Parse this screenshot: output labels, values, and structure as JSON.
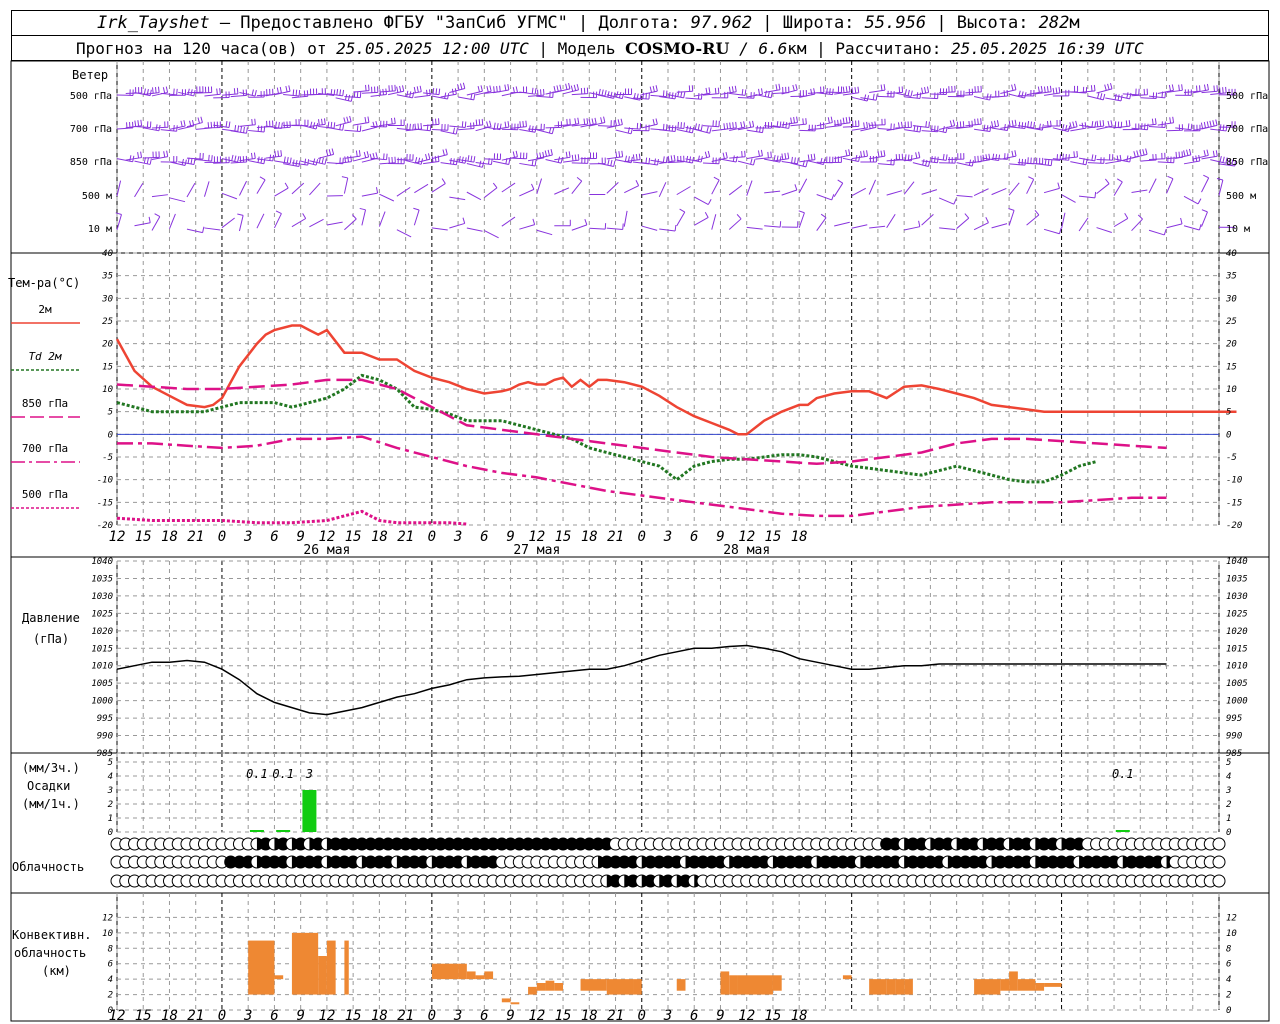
{
  "header": {
    "station": "Irk_Tayshet",
    "provider": " — Предоставлено ФГБУ \"ЗапСиб УГМС\" | Долгота: ",
    "lon": "97.962",
    "lat_label": " | Широта: ",
    "lat": "55.956",
    "alt_label": " | Высота: ",
    "alt": "282",
    "alt_unit": "м",
    "forecast_label": "Прогноз на 120 часа(ов) от ",
    "forecast_from": "25.05.2025 12:00 UTC",
    "model_label": "  | Модель ",
    "model": "COSMO-RU",
    "res": " / 6.6",
    "res_unit": "км",
    "calc_label": " | Рассчитано: ",
    "calc_time": "25.05.2025 16:39 UTC"
  },
  "panels": {
    "wind": {
      "title": "Ветер",
      "levels": [
        "500 гПа",
        "700 гПа",
        "850 гПа",
        "500 м",
        "10  м"
      ]
    },
    "temp": {
      "title": "Тем-ра(°С)",
      "legend": [
        "2м",
        "Td  2м",
        "850 гПа",
        "700 гПа",
        "500 гПа"
      ],
      "legend_colors": [
        "#ee4433",
        "#227722",
        "#dd1188",
        "#dd1188",
        "#dd1188"
      ],
      "ylim": [
        -20,
        40
      ]
    },
    "pressure": {
      "title": "Давление",
      "unit": "(гПа)",
      "ylim": [
        985,
        1040
      ]
    },
    "precip": {
      "title_top": "(мм/3ч.)",
      "title": "Осадки",
      "title_bottom": "(мм/1ч.)",
      "ylim": [
        0,
        5
      ],
      "annotations": [
        {
          "t": 16,
          "label": "0.1"
        },
        {
          "t": 19,
          "label": "0.1"
        },
        {
          "t": 22,
          "label": "3"
        },
        {
          "t": 115,
          "label": "0.1"
        }
      ]
    },
    "clouds": {
      "title": "Облачность"
    },
    "conv": {
      "title": [
        "Конвективн.",
        "облачность",
        "(км)"
      ],
      "ylim": [
        0,
        14
      ]
    }
  },
  "xaxis": {
    "hour_labels": [
      "12",
      "15",
      "18",
      "21",
      "0",
      "3",
      "6",
      "9",
      "12",
      "15",
      "18",
      "21",
      "0",
      "3",
      "6",
      "9",
      "12",
      "15",
      "18",
      "21",
      "0",
      "3",
      "6",
      "9",
      "12",
      "15",
      "18"
    ],
    "day_labels": [
      {
        "t": 24,
        "label": "26 мая"
      },
      {
        "t": 48,
        "label": "27 мая"
      },
      {
        "t": 72,
        "label": "28 мая"
      }
    ]
  },
  "chart_data": [
    {
      "type": "line",
      "title": "Тем-ра(°С)",
      "xlabel": "",
      "ylabel": "",
      "ylim": [
        -20,
        40
      ],
      "series": [
        {
          "name": "2м",
          "x": [
            0,
            2,
            4,
            6,
            8,
            10,
            11,
            12,
            14,
            16,
            17,
            18,
            20,
            21,
            22,
            23,
            24,
            26,
            28,
            30,
            32,
            34,
            36,
            38,
            40,
            42,
            44,
            45,
            46,
            47,
            48,
            49,
            50,
            51,
            52,
            53,
            54,
            55,
            56,
            58,
            60,
            62,
            64,
            66,
            68,
            70,
            71,
            72,
            74,
            76,
            78,
            79,
            80,
            82,
            84,
            86,
            88,
            90,
            92,
            94,
            96,
            98,
            100,
            102,
            104,
            106,
            108,
            110,
            112,
            114,
            116,
            118,
            120,
            122,
            124,
            126,
            128
          ],
          "y": [
            21,
            14,
            10.5,
            8.5,
            6.5,
            6,
            6.5,
            8,
            15,
            20,
            22,
            23,
            24,
            24,
            23,
            22,
            23,
            18,
            18,
            16.5,
            16.5,
            14,
            12.5,
            11.5,
            10,
            9,
            9.5,
            10,
            11,
            11.5,
            11,
            11,
            12,
            12.5,
            10.5,
            12,
            10.5,
            12,
            12,
            11.5,
            10.5,
            8.5,
            6,
            4,
            2.5,
            1,
            0,
            0,
            3,
            5,
            6.5,
            6.5,
            8,
            9,
            9.5,
            9.5,
            8,
            10.5,
            10.8,
            10,
            9,
            8,
            6.5,
            6,
            5.5,
            5,
            5,
            5,
            5,
            5,
            5,
            5,
            5,
            5,
            5,
            5,
            5
          ]
        },
        {
          "name": "Td  2м",
          "x": [
            0,
            2,
            4,
            6,
            8,
            10,
            12,
            14,
            16,
            18,
            20,
            22,
            24,
            26,
            28,
            30,
            32,
            34,
            36,
            38,
            40,
            42,
            44,
            46,
            48,
            50,
            52,
            54,
            56,
            58,
            60,
            62,
            64,
            66,
            68,
            70,
            72,
            74,
            76,
            78,
            80,
            82,
            84,
            86,
            88,
            90,
            92,
            94,
            96,
            98,
            100,
            102,
            104,
            106,
            108,
            110,
            112
          ],
          "y": [
            7,
            6,
            5,
            5,
            5,
            5,
            6,
            7,
            7,
            7,
            6,
            7,
            8,
            10,
            13,
            12,
            10,
            6,
            5.5,
            4.5,
            3,
            3,
            3,
            2,
            1,
            0,
            -1,
            -3,
            -4,
            -5,
            -6,
            -7,
            -10,
            -7,
            -6,
            -5.5,
            -5.5,
            -5,
            -4.5,
            -4.5,
            -5,
            -6,
            -7,
            -7.5,
            -8,
            -8.5,
            -9,
            -8,
            -7,
            -8,
            -9,
            -10,
            -10.5,
            -10.5,
            -9,
            -7,
            -6
          ]
        },
        {
          "name": "850 гПа",
          "x": [
            0,
            4,
            8,
            12,
            16,
            20,
            24,
            26,
            28,
            30,
            32,
            34,
            36,
            38,
            40,
            44,
            48,
            52,
            56,
            60,
            64,
            68,
            72,
            76,
            80,
            84,
            88,
            92,
            96,
            100,
            104,
            108,
            112,
            116,
            120
          ],
          "y": [
            11,
            10.5,
            10,
            10,
            10.5,
            11,
            12,
            12,
            12,
            11,
            10,
            8,
            6,
            4,
            2,
            1,
            0,
            -1,
            -2,
            -3,
            -4,
            -5,
            -5.5,
            -6,
            -6.5,
            -6,
            -5,
            -4,
            -2,
            -1,
            -1,
            -1.5,
            -2,
            -2.5,
            -3
          ]
        },
        {
          "name": "700 гПа",
          "x": [
            0,
            4,
            8,
            12,
            16,
            20,
            24,
            28,
            32,
            36,
            40,
            44,
            48,
            52,
            56,
            60,
            64,
            68,
            72,
            76,
            80,
            84,
            88,
            92,
            96,
            100,
            104,
            108,
            112,
            116,
            120
          ],
          "y": [
            -2,
            -2,
            -2.5,
            -3,
            -2.5,
            -1,
            -1,
            -0.5,
            -3,
            -5,
            -7,
            -8.5,
            -9.5,
            -11,
            -12.5,
            -13.5,
            -14.5,
            -15.5,
            -16.5,
            -17.5,
            -18,
            -18,
            -17,
            -16,
            -15.5,
            -15,
            -15,
            -15,
            -14.5,
            -14,
            -14
          ]
        },
        {
          "name": "500 гПа",
          "x": [
            0,
            4,
            8,
            12,
            16,
            20,
            24,
            26,
            28,
            30,
            32,
            34,
            36,
            38,
            40
          ],
          "y": [
            -18.5,
            -19,
            -19,
            -19,
            -19.5,
            -19.5,
            -19,
            -18,
            -17,
            -19,
            -19.5,
            -19.5,
            -19.5,
            -19.5,
            -19.8
          ]
        }
      ]
    },
    {
      "type": "line",
      "title": "Давление",
      "xlabel": "",
      "ylabel": "(гПа)",
      "ylim": [
        985,
        1040
      ],
      "series": [
        {
          "name": "",
          "x": [
            0,
            2,
            4,
            6,
            8,
            10,
            12,
            14,
            16,
            18,
            20,
            22,
            24,
            26,
            28,
            30,
            32,
            34,
            36,
            38,
            40,
            42,
            44,
            46,
            48,
            50,
            52,
            54,
            56,
            58,
            60,
            62,
            64,
            66,
            68,
            70,
            72,
            74,
            76,
            78,
            80,
            82,
            84,
            86,
            88,
            90,
            92,
            94,
            96,
            98,
            100,
            102,
            104,
            106,
            108,
            110,
            112,
            114,
            116,
            118,
            120
          ],
          "y": [
            1009,
            1010,
            1011,
            1011,
            1011.5,
            1011,
            1009,
            1006,
            1002,
            999.5,
            998,
            996.5,
            996,
            997,
            998,
            999.5,
            1001,
            1002,
            1003.5,
            1004.5,
            1006,
            1006.5,
            1006.8,
            1007,
            1007.5,
            1008,
            1008.5,
            1009,
            1009,
            1010,
            1011.5,
            1013,
            1014,
            1015,
            1015,
            1015.5,
            1015.8,
            1015,
            1014,
            1012,
            1011,
            1010,
            1009,
            1009,
            1009.5,
            1010,
            1010,
            1010.5,
            1010.5,
            1010.5,
            1010.5,
            1010.5,
            1010.5,
            1010.5,
            1010.5,
            1010.5,
            1010.5,
            1010.5,
            1010.5,
            1010.5,
            1010.5
          ]
        }
      ]
    },
    {
      "type": "bar",
      "title": "Осадки",
      "xlabel": "",
      "ylabel": "(мм/3ч.)",
      "ylim": [
        0,
        5
      ],
      "series": [
        {
          "name": "",
          "x": [
            16,
            19,
            22,
            115
          ],
          "values": [
            0.1,
            0.1,
            3,
            0.1
          ]
        }
      ]
    },
    {
      "type": "bar",
      "title": "Конвективн. облачность",
      "xlabel": "",
      "ylabel": "(км)",
      "ylim": [
        0,
        14
      ],
      "series": [
        {
          "name": "",
          "x_start": [
            15,
            18,
            20,
            23,
            24,
            26,
            36,
            39,
            40,
            41,
            42,
            44,
            45,
            47,
            48,
            49,
            50,
            53,
            56,
            59,
            64,
            69,
            70,
            71,
            75,
            83,
            86,
            88,
            89,
            90,
            98,
            101,
            102,
            103,
            105,
            106
          ],
          "x_end": [
            18,
            19,
            23,
            24,
            25,
            26.5,
            39,
            40,
            41,
            42,
            43,
            45,
            46,
            48,
            49,
            50,
            51,
            56,
            59,
            60,
            65,
            70,
            71,
            75,
            76,
            84,
            88,
            89,
            90,
            91,
            101,
            102,
            103,
            105,
            106,
            108
          ],
          "bottom": [
            2,
            4,
            2,
            2,
            2,
            2,
            4,
            4,
            4,
            4,
            4,
            1,
            1,
            2,
            2.5,
            2.5,
            2.5,
            2.5,
            2,
            2,
            2.5,
            2,
            2,
            2,
            2.5,
            4,
            2,
            2,
            2,
            2,
            2,
            2.5,
            2.5,
            2.5,
            2.5,
            3
          ],
          "top": [
            9,
            4.5,
            10,
            7,
            9,
            9,
            6,
            6,
            5,
            4.5,
            5,
            1.5,
            1,
            3,
            3.5,
            3.8,
            3.5,
            4,
            4,
            4,
            4,
            5,
            4.5,
            4.5,
            4.5,
            4.5,
            4,
            4,
            4,
            4,
            4,
            4,
            5,
            4,
            3.5,
            3.5
          ]
        }
      ]
    }
  ]
}
